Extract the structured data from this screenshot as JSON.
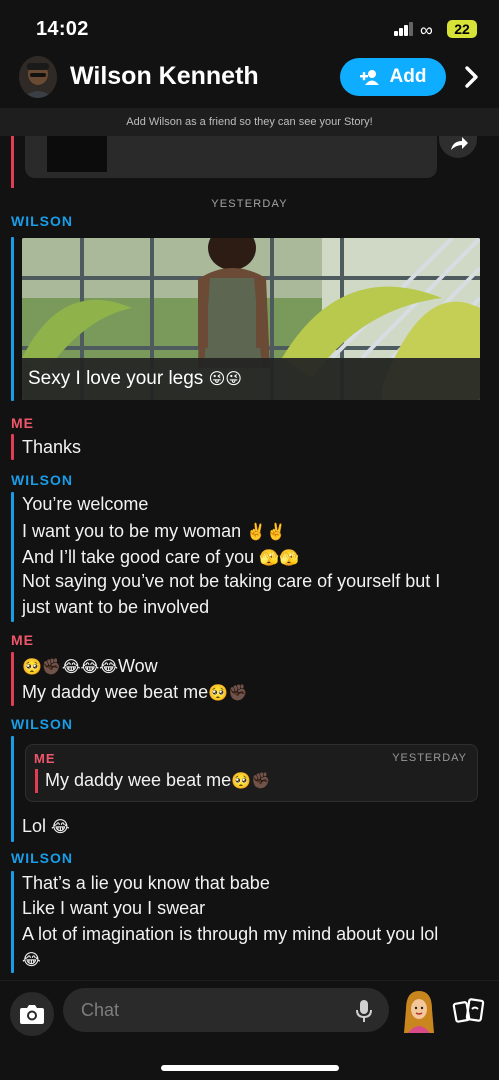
{
  "status": {
    "time": "14:02",
    "battery": "22"
  },
  "header": {
    "contact_name": "Wilson Kenneth",
    "add_label": "Add"
  },
  "banner": "Add Wilson as a friend so they can see your Story!",
  "divider": "YESTERDAY",
  "senders": {
    "wilson": "WILSON",
    "me": "ME"
  },
  "messages": {
    "snap_caption": "Sexy I love your legs",
    "snap_caption_emoji": "😜😜",
    "me1": "Thanks",
    "w1": "You’re welcome",
    "w2": "I want you to be my woman",
    "w2_emoji": "✌️✌️",
    "w3": "And I’ll take good care of you",
    "w3_emoji": "🫣🫣",
    "w4a": "Not saying you’ve not be taking care of yourself but I",
    "w4b": "just want to be involved",
    "me2_emoji": "🥺✊🏿😂😂😂",
    "me2_text": "Wow",
    "me3": "My daddy wee beat me",
    "me3_emoji": "🥺✊🏿",
    "quote_sender": "ME",
    "quote_time": "YESTERDAY",
    "quote_text": "My daddy wee beat me",
    "quote_emoji": "🥺✊🏿",
    "w5": "Lol",
    "w5_emoji": "😂",
    "w6": "That’s a lie you know that babe",
    "w7": "Like I want you I swear",
    "w8": "A lot of imagination is through my mind about you lol",
    "w9_emoji": "😂"
  },
  "composer": {
    "placeholder": "Chat"
  },
  "colors": {
    "accent": "#0fadff",
    "wilson": "#1a9de8",
    "me": "#f0566b",
    "battery": "#d7e337"
  }
}
